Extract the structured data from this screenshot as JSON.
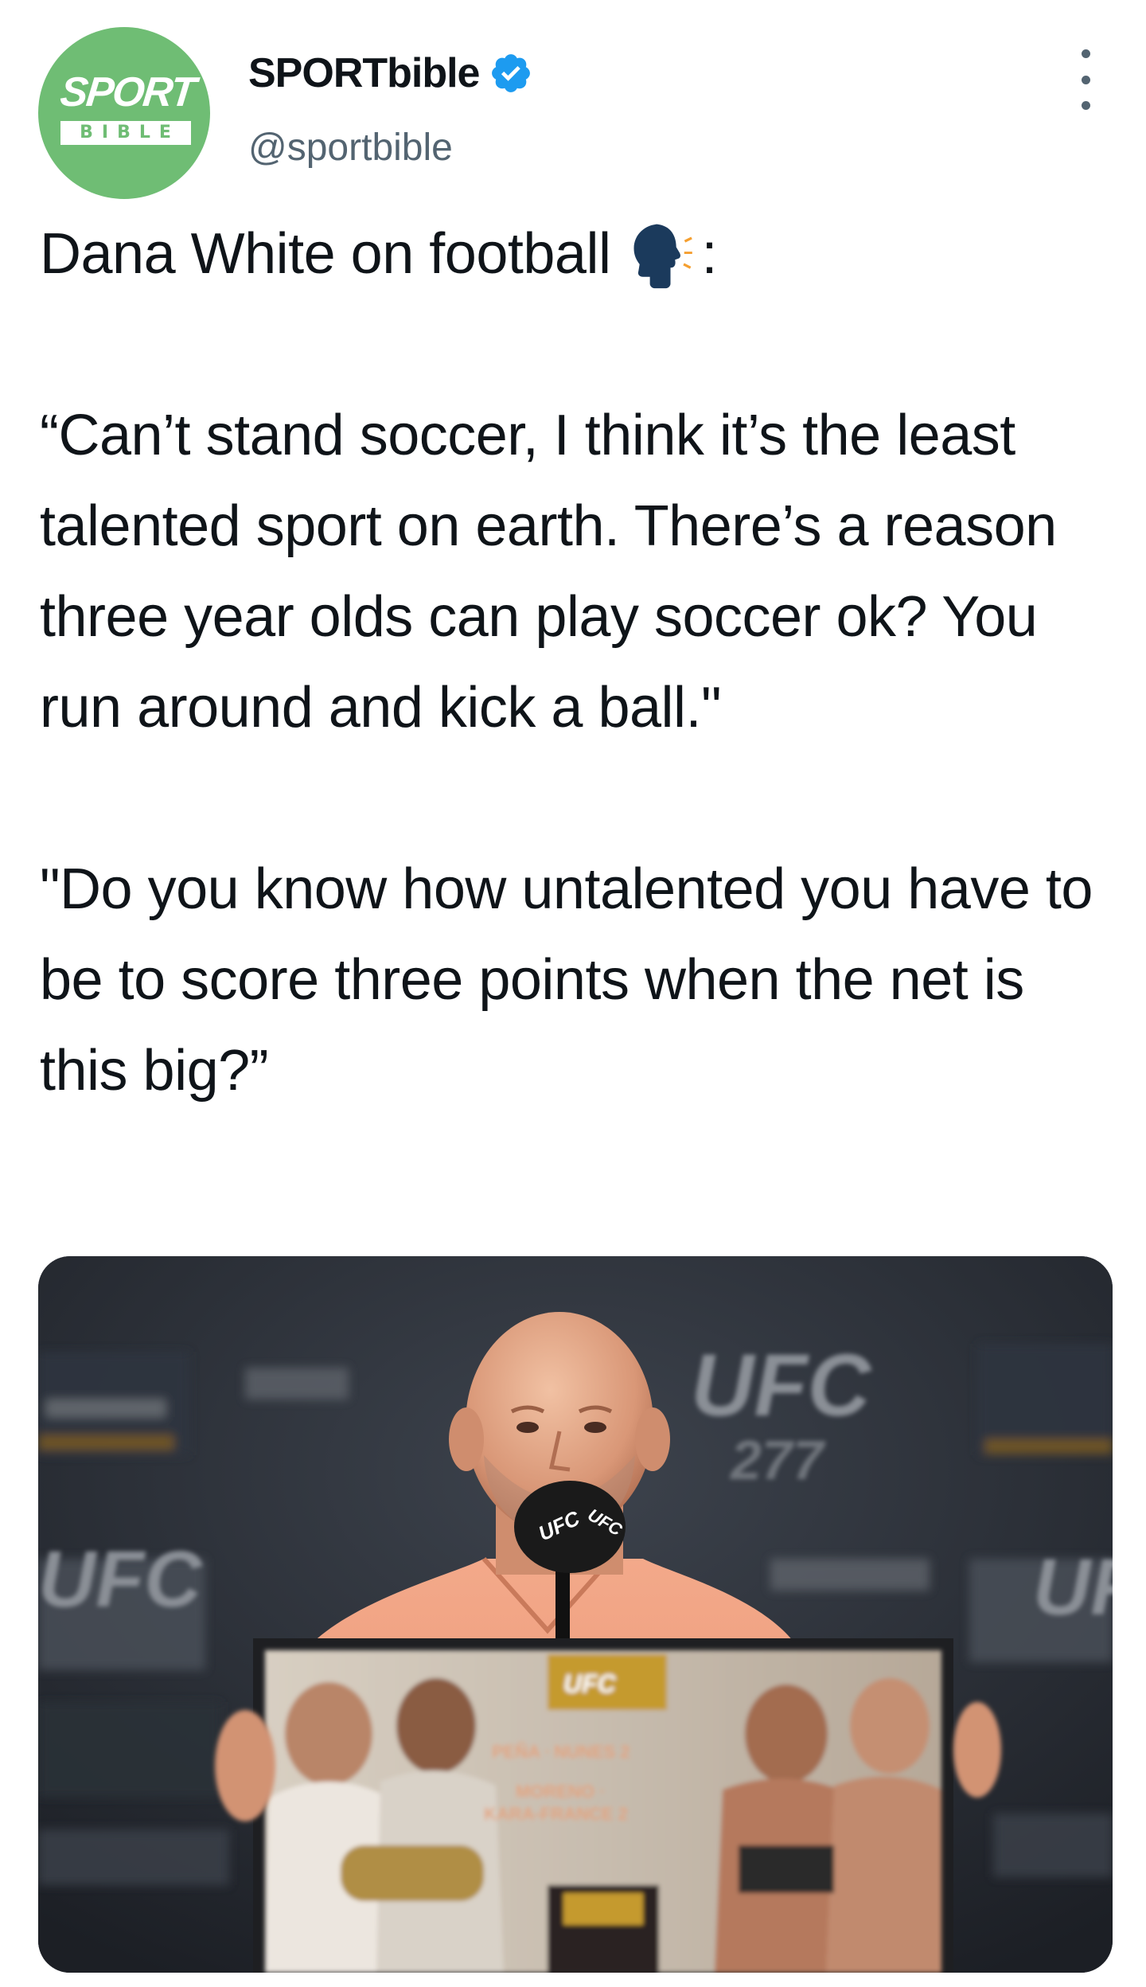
{
  "account": {
    "avatar_text_top": "SPORT",
    "avatar_text_bottom": "BIBLE",
    "avatar_color": "#6fbd74",
    "name": "SPORTbible",
    "handle": "@sportbible",
    "verified_icon": "verified-badge-icon",
    "verified_color": "#1d9bf0"
  },
  "tweet": {
    "line1_text": "Dana White on football",
    "line1_emoji": "speaking-head-icon",
    "line1_suffix": ":",
    "quote1": "“Can’t stand soccer, I think it’s the least talented sport on earth. There’s a reason three year olds can play soccer ok? You run around and kick a ball.\"",
    "quote2": "\"Do you know how untalented you have to be to score three points when the net is this big?”"
  },
  "media": {
    "backdrop_logo": "UFC",
    "backdrop_sub": "277",
    "mic_label": "UFC",
    "podium_badge": "UFC",
    "podium_line1": "PEÑA ᐧ NUNES 2",
    "podium_line2": "MORENO ᐧ",
    "podium_line3": "KARA-FRANCE 2"
  }
}
